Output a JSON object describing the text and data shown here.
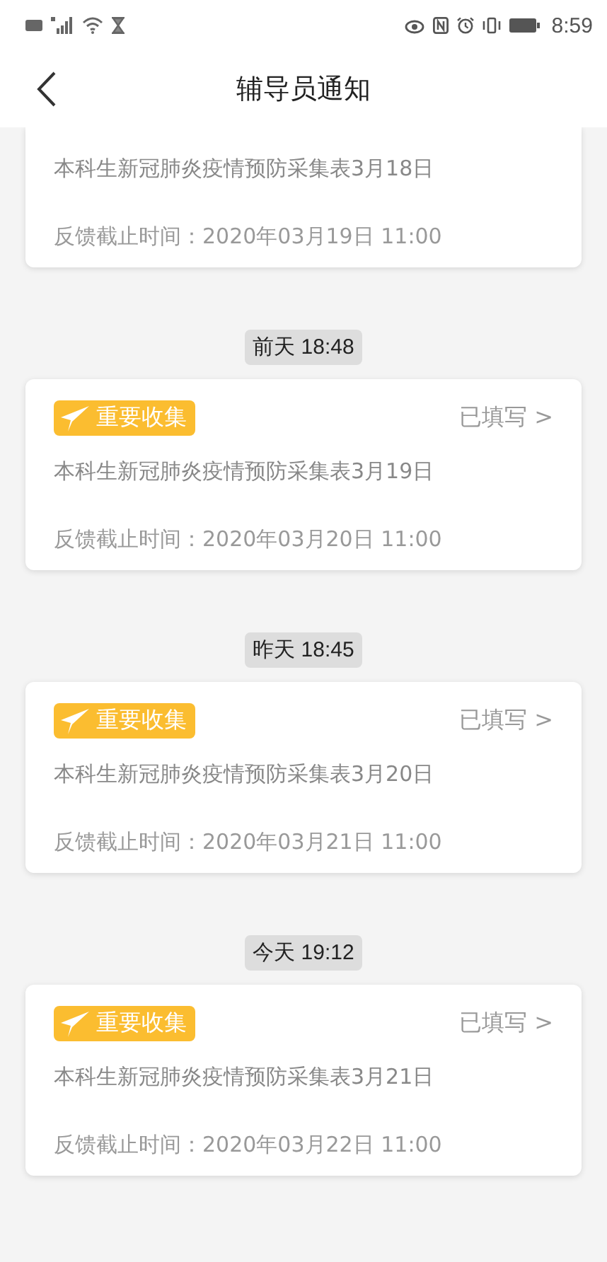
{
  "status_bar": {
    "time": "8:59"
  },
  "nav": {
    "title": "辅导员通知"
  },
  "notices": [
    {
      "kind": "partial",
      "title": "本科生新冠肺炎疫情预防采集表3月18日",
      "deadline": "反馈截止时间：2020年03月19日 11:00"
    },
    {
      "kind": "full",
      "time": "前天 18:48",
      "badge": "重要收集",
      "status": "已填写 >",
      "title": "本科生新冠肺炎疫情预防采集表3月19日",
      "deadline": "反馈截止时间：2020年03月20日 11:00"
    },
    {
      "kind": "full",
      "time": "昨天 18:45",
      "badge": "重要收集",
      "status": "已填写 >",
      "title": "本科生新冠肺炎疫情预防采集表3月20日",
      "deadline": "反馈截止时间：2020年03月21日 11:00"
    },
    {
      "kind": "full",
      "time": "今天 19:12",
      "badge": "重要收集",
      "status": "已填写 >",
      "title": "本科生新冠肺炎疫情预防采集表3月21日",
      "deadline": "反馈截止时间：2020年03月22日 11:00"
    }
  ]
}
